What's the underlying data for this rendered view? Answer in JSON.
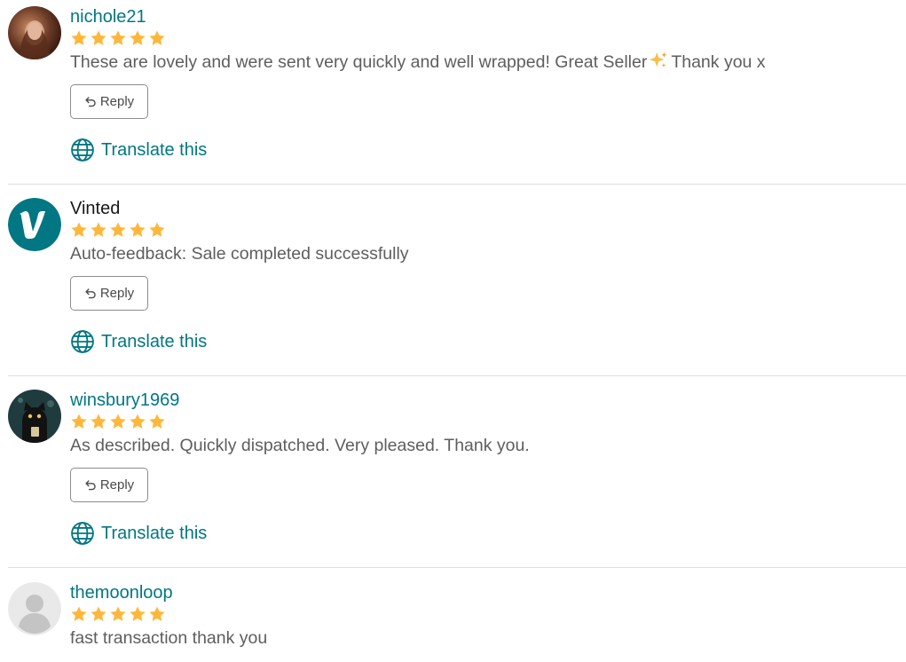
{
  "colors": {
    "accent": "#007782",
    "star": "#FFB73A",
    "text": "#5E5E5E",
    "divider": "#DDDDDD"
  },
  "reviews": [
    {
      "username": "nichole21",
      "rating": 5,
      "avatar_icon": "user-photo-avatar",
      "text": "These are lovely and were sent very quickly and well wrapped! Great Seller",
      "text_after": "Thank you x",
      "emoji": "sparkles-icon",
      "reply_label": "Reply",
      "translate_label": "Translate this"
    },
    {
      "username": "Vinted",
      "rating": 5,
      "avatar_icon": "vinted-logo",
      "text": "Auto-feedback: Sale completed successfully",
      "reply_label": "Reply",
      "translate_label": "Translate this"
    },
    {
      "username": "winsbury1969",
      "rating": 5,
      "avatar_icon": "cat-photo-avatar",
      "text": "As described. Quickly dispatched. Very pleased. Thank you.",
      "reply_label": "Reply",
      "translate_label": "Translate this"
    },
    {
      "username": "themoonloop",
      "rating": 5,
      "avatar_icon": "default-user-avatar",
      "text": "fast transaction thank you"
    }
  ]
}
